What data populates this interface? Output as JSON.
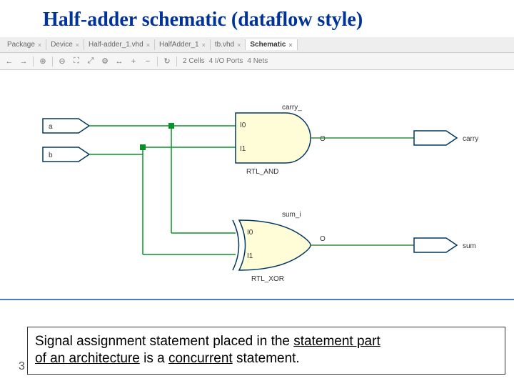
{
  "title": "Half-adder schematic (dataflow style)",
  "tabs": [
    {
      "label": "Package"
    },
    {
      "label": "Device"
    },
    {
      "label": "Half-adder_1.vhd"
    },
    {
      "label": "HalfAdder_1"
    },
    {
      "label": "tb.vhd"
    },
    {
      "label": "Schematic",
      "active": true
    }
  ],
  "toolbar_info": {
    "cells": "2 Cells",
    "io": "4 I/O Ports",
    "nets": "4 Nets"
  },
  "schematic": {
    "inputs": [
      {
        "name": "a"
      },
      {
        "name": "b"
      }
    ],
    "gates": [
      {
        "type": "AND",
        "label": "RTL_AND",
        "header": "carry_",
        "i0": "I0",
        "i1": "I1",
        "out": "O"
      },
      {
        "type": "XOR",
        "label": "RTL_XOR",
        "header": "sum_i",
        "i0": "I0",
        "i1": "I1",
        "out": "O"
      }
    ],
    "outputs": [
      {
        "name": "carry"
      },
      {
        "name": "sum"
      }
    ]
  },
  "footer": {
    "line1a": "Signal assignment statement placed in the ",
    "line1b": "statement part",
    "line2a": "of an architecture",
    "line2b": " is a ",
    "line2c": "concurrent",
    "line2d": " statement."
  },
  "page_number": "3"
}
